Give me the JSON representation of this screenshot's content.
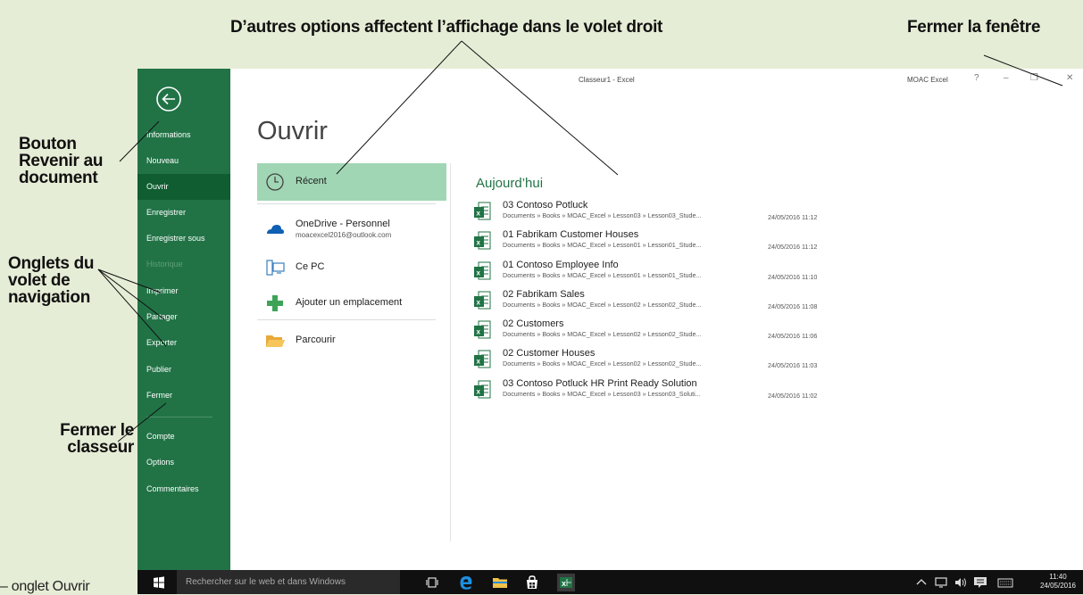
{
  "annotations": {
    "top": "D’autres options affectent l’affichage dans le volet droit",
    "close_window": "Fermer la fenêtre",
    "back_button": "Bouton Revenir au document",
    "nav_tabs": "Onglets du volet de navigation",
    "close_workbook": "Fermer le classeur",
    "bottom_caption": "– onglet Ouvrir"
  },
  "window": {
    "title": "Classeur1 - Excel",
    "account": "MOAC Excel",
    "help": "?",
    "minimize": "–",
    "restore": "❐",
    "close": "✕"
  },
  "nav": {
    "items": [
      {
        "label": "Informations"
      },
      {
        "label": "Nouveau"
      },
      {
        "label": "Ouvrir"
      },
      {
        "label": "Enregistrer"
      },
      {
        "label": "Enregistrer sous"
      },
      {
        "label": "Historique"
      },
      {
        "label": "Imprimer"
      },
      {
        "label": "Partager"
      },
      {
        "label": "Exporter"
      },
      {
        "label": "Publier"
      },
      {
        "label": "Fermer"
      },
      {
        "label": "Compte"
      },
      {
        "label": "Options"
      },
      {
        "label": "Commentaires"
      }
    ]
  },
  "page_title": "Ouvrir",
  "locations": [
    {
      "label": "Récent",
      "sub": ""
    },
    {
      "label": "OneDrive - Personnel",
      "sub": "moacexcel2016@outlook.com"
    },
    {
      "label": "Ce PC",
      "sub": ""
    },
    {
      "label": "Ajouter un emplacement",
      "sub": ""
    },
    {
      "label": "Parcourir",
      "sub": ""
    }
  ],
  "recent": {
    "group": "Aujourd’hui",
    "files": [
      {
        "name": "03 Contoso Potluck",
        "path": "Documents » Books » MOAC_Excel » Lesson03 » Lesson03_Stude...",
        "date": "24/05/2016 11:12"
      },
      {
        "name": "01 Fabrikam Customer Houses",
        "path": "Documents » Books » MOAC_Excel » Lesson01 » Lesson01_Stude...",
        "date": "24/05/2016 11:12"
      },
      {
        "name": "01 Contoso Employee Info",
        "path": "Documents » Books » MOAC_Excel » Lesson01 » Lesson01_Stude...",
        "date": "24/05/2016 11:10"
      },
      {
        "name": "02 Fabrikam Sales",
        "path": "Documents » Books » MOAC_Excel » Lesson02 » Lesson02_Stude...",
        "date": "24/05/2016 11:08"
      },
      {
        "name": "02 Customers",
        "path": "Documents » Books » MOAC_Excel » Lesson02 » Lesson02_Stude...",
        "date": "24/05/2016 11:06"
      },
      {
        "name": "02 Customer Houses",
        "path": "Documents » Books » MOAC_Excel » Lesson02 » Lesson02_Stude...",
        "date": "24/05/2016 11:03"
      },
      {
        "name": "03 Contoso Potluck HR Print Ready Solution",
        "path": "Documents » Books » MOAC_Excel » Lesson03 » Lesson03_Soluti...",
        "date": "24/05/2016 11:02"
      }
    ]
  },
  "taskbar": {
    "search_placeholder": "Rechercher sur le web et dans Windows",
    "time": "11:40",
    "date": "24/05/2016"
  },
  "colors": {
    "accent": "#217346",
    "nav_active": "#0f5d30",
    "selected_location": "#a0d6b4",
    "annotation_bg": "#e6edd6"
  }
}
